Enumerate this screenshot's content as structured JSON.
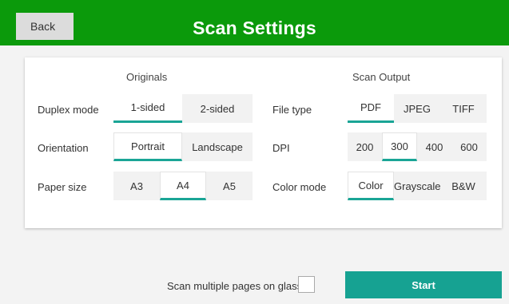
{
  "header": {
    "back_label": "Back",
    "title": "Scan Settings",
    "bg_color": "#0b9a0b"
  },
  "originals": {
    "title": "Originals",
    "duplex": {
      "label": "Duplex mode",
      "options": [
        "1-sided",
        "2-sided"
      ],
      "selected": "1-sided"
    },
    "orientation": {
      "label": "Orientation",
      "options": [
        "Portrait",
        "Landscape"
      ],
      "selected": "Portrait"
    },
    "paper_size": {
      "label": "Paper size",
      "options": [
        "A3",
        "A4",
        "A5"
      ],
      "selected": "A4"
    }
  },
  "output": {
    "title": "Scan Output",
    "file_type": {
      "label": "File type",
      "options": [
        "PDF",
        "JPEG",
        "TIFF"
      ],
      "selected": "PDF"
    },
    "dpi": {
      "label": "DPI",
      "options": [
        "200",
        "300",
        "400",
        "600"
      ],
      "selected": "300"
    },
    "color_mode": {
      "label": "Color mode",
      "options": [
        "Color",
        "Grayscale",
        "B&W"
      ],
      "selected": "Color"
    }
  },
  "footer": {
    "multi_page_label": "Scan multiple pages on glass",
    "multi_page_checked": false,
    "start_label": "Start"
  },
  "colors": {
    "accent": "#1aa596",
    "start_button": "#16a292"
  }
}
